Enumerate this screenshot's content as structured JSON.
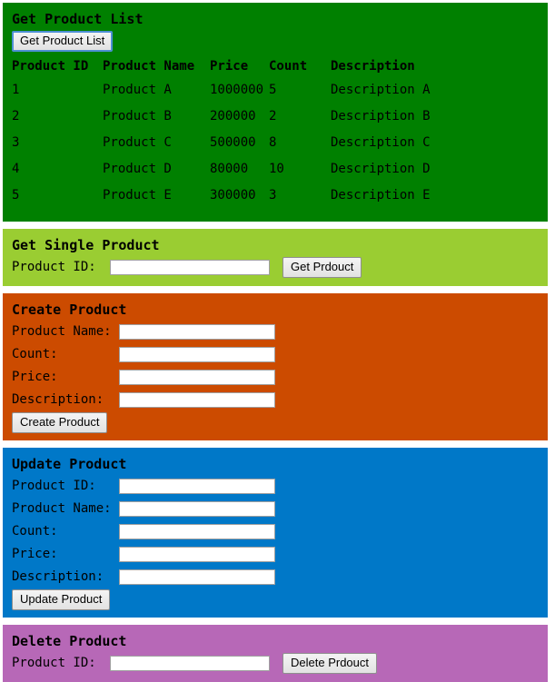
{
  "sections": {
    "get_list": {
      "title": "Get Product List",
      "color": "#008000",
      "button_label": "Get Product List",
      "table": {
        "columns": [
          "Product ID",
          "Product Name",
          "Price",
          "Count",
          "Description"
        ],
        "rows": [
          {
            "id": "1",
            "name": "Product A",
            "price": "1000000",
            "count": "5",
            "description": "Description A"
          },
          {
            "id": "2",
            "name": "Product B",
            "price": "200000",
            "count": "2",
            "description": "Description B"
          },
          {
            "id": "3",
            "name": "Product C",
            "price": "500000",
            "count": "8",
            "description": "Description C"
          },
          {
            "id": "4",
            "name": "Product D",
            "price": "80000",
            "count": "10",
            "description": "Description D"
          },
          {
            "id": "5",
            "name": "Product E",
            "price": "300000",
            "count": "3",
            "description": "Description E"
          }
        ]
      }
    },
    "get_single": {
      "title": "Get Single Product",
      "color": "#9acd32",
      "label_product_id": "Product ID:",
      "input_value": "",
      "button_label": "Get Prdouct"
    },
    "create": {
      "title": "Create Product",
      "color": "#cc4b00",
      "label_product_name": "Product Name:",
      "label_count": "Count:",
      "label_price": "Price:",
      "label_description": "Description:",
      "value_product_name": "",
      "value_count": "",
      "value_price": "",
      "value_description": "",
      "button_label": "Create Product"
    },
    "update": {
      "title": "Update Product",
      "color": "#0078c8",
      "label_product_id": "Product ID:",
      "label_product_name": "Product Name:",
      "label_count": "Count:",
      "label_price": "Price:",
      "label_description": "Description:",
      "value_product_id": "",
      "value_product_name": "",
      "value_count": "",
      "value_price": "",
      "value_description": "",
      "button_label": "Update Product"
    },
    "delete": {
      "title": "Delete Product",
      "color": "#b768b7",
      "label_product_id": "Product ID:",
      "input_value": "",
      "button_label": "Delete Prdouct"
    }
  }
}
